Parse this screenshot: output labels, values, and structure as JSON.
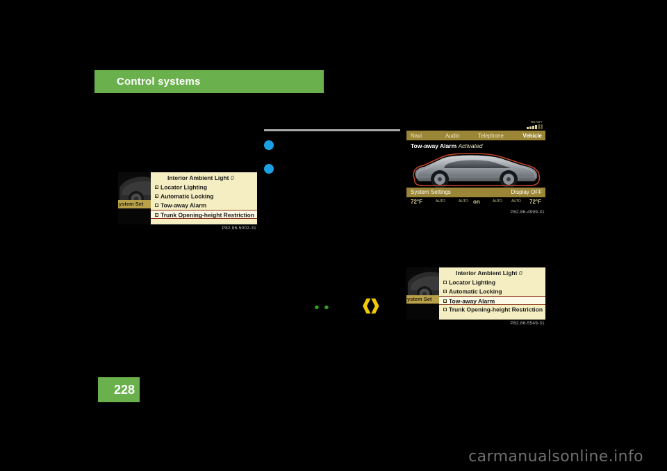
{
  "page": {
    "chapter_title": "Control systems",
    "page_number": "228",
    "watermark": "carmanualsonline.info",
    "accent_green": "#6ab04c"
  },
  "symbols": {
    "green_dot_1": "●",
    "green_dot_2": "●",
    "yellow_bracket_left": "❰",
    "yellow_bracket_right": "❱"
  },
  "figures": [
    {
      "id": "fig-left-settings",
      "caption": "P82.86-5002-31",
      "screen": {
        "type": "menu-list",
        "side_tab_label": "ystem Set",
        "header_label": "Interior Ambient Light",
        "header_value": "0",
        "rows": [
          {
            "label": "Locator Lighting",
            "checked": true,
            "highlighted": false
          },
          {
            "label": "Automatic Locking",
            "checked": true,
            "highlighted": false
          },
          {
            "label": "Tow-away Alarm",
            "checked": false,
            "highlighted": false
          },
          {
            "label": "Trunk Opening-height Restriction",
            "checked": true,
            "highlighted": true
          }
        ]
      }
    },
    {
      "id": "fig-top-right-vehicle",
      "caption": "P82.86-4999-31",
      "screen": {
        "type": "vehicle-alarm",
        "status_ready": "READY",
        "tabs": [
          {
            "label": "Navi",
            "active": false
          },
          {
            "label": "Audio",
            "active": false
          },
          {
            "label": "Telephone",
            "active": false
          },
          {
            "label": "Vehicle",
            "active": true
          }
        ],
        "alarm_label": "Tow-away Alarm",
        "alarm_state": "Activated",
        "bottom_left_label": "System Settings",
        "bottom_right_label": "Display OFF",
        "climate": {
          "temp_left": "72°F",
          "temp_right": "72°F",
          "auto_left": "AUTO",
          "auto_right": "AUTO",
          "fan_left": "AUTO",
          "fan_right": "AUTO",
          "center": "on"
        }
      }
    },
    {
      "id": "fig-bottom-right-settings",
      "caption": "P82.86-5549-31",
      "screen": {
        "type": "menu-list",
        "side_tab_label": "ystem Set",
        "header_label": "Interior Ambient Light",
        "header_value": "0",
        "rows": [
          {
            "label": "Locator Lighting",
            "checked": false,
            "highlighted": false
          },
          {
            "label": "Automatic Locking",
            "checked": true,
            "highlighted": false
          },
          {
            "label": "Tow-away Alarm",
            "checked": true,
            "highlighted": true
          },
          {
            "label": "Trunk Opening-height Restriction",
            "checked": false,
            "highlighted": false
          }
        ]
      }
    }
  ]
}
